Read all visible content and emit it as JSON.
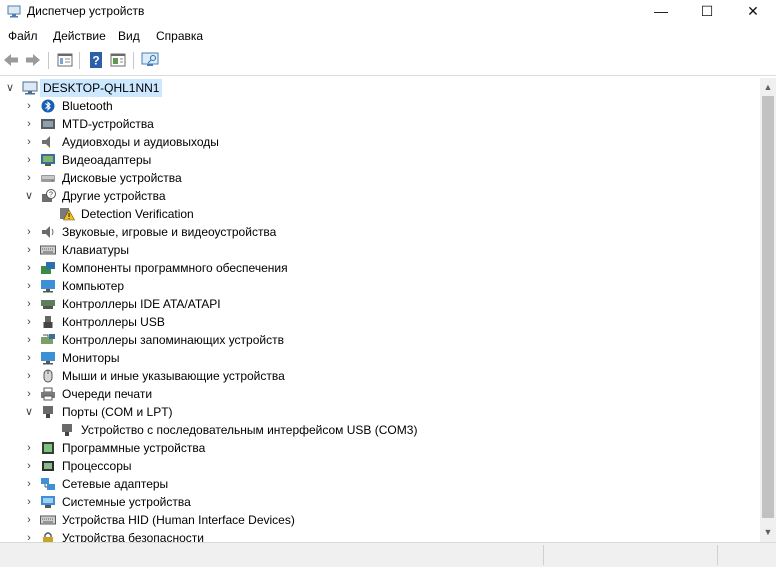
{
  "window": {
    "title": "Диспетчер устройств",
    "minimize": "—",
    "maximize": "☐",
    "close": "✕"
  },
  "menu": [
    "Файл",
    "Действие",
    "Вид",
    "Справка"
  ],
  "toolbar": [
    "back-icon",
    "forward-icon",
    "properties-icon",
    "help-icon",
    "update-driver-icon",
    "scan-hardware-icon"
  ],
  "tree": {
    "root": "DESKTOP-QHL1NN1",
    "rows": [
      {
        "label": "Bluetooth",
        "icon": "bluetooth-icon",
        "expanded": false,
        "level": 1
      },
      {
        "label": "MTD-устройства",
        "icon": "mtd-icon",
        "expanded": false,
        "level": 1
      },
      {
        "label": "Аудиовходы и аудиовыходы",
        "icon": "audio-io-icon",
        "expanded": false,
        "level": 1
      },
      {
        "label": "Видеоадаптеры",
        "icon": "display-adapter-icon",
        "expanded": false,
        "level": 1
      },
      {
        "label": "Дисковые устройства",
        "icon": "disk-icon",
        "expanded": false,
        "level": 1
      },
      {
        "label": "Другие устройства",
        "icon": "unknown-device-icon",
        "expanded": true,
        "level": 1
      },
      {
        "label": "Detection Verification",
        "icon": "warning-device-icon",
        "level": 2
      },
      {
        "label": "Звуковые, игровые и видеоустройства",
        "icon": "sound-icon",
        "expanded": false,
        "level": 1
      },
      {
        "label": "Клавиатуры",
        "icon": "keyboard-icon",
        "expanded": false,
        "level": 1
      },
      {
        "label": "Компоненты программного обеспечения",
        "icon": "software-component-icon",
        "expanded": false,
        "level": 1
      },
      {
        "label": "Компьютер",
        "icon": "computer-icon",
        "expanded": false,
        "level": 1
      },
      {
        "label": "Контроллеры IDE ATA/ATAPI",
        "icon": "ide-controller-icon",
        "expanded": false,
        "level": 1
      },
      {
        "label": "Контроллеры USB",
        "icon": "usb-icon",
        "expanded": false,
        "level": 1
      },
      {
        "label": "Контроллеры запоминающих устройств",
        "icon": "storage-controller-icon",
        "expanded": false,
        "level": 1
      },
      {
        "label": "Мониторы",
        "icon": "monitor-icon",
        "expanded": false,
        "level": 1
      },
      {
        "label": "Мыши и иные указывающие устройства",
        "icon": "mouse-icon",
        "expanded": false,
        "level": 1
      },
      {
        "label": "Очереди печати",
        "icon": "printer-icon",
        "expanded": false,
        "level": 1
      },
      {
        "label": "Порты (COM и LPT)",
        "icon": "port-icon",
        "expanded": true,
        "level": 1
      },
      {
        "label": "Устройство с последовательным интерфейсом USB (COM3)",
        "icon": "serial-port-icon",
        "level": 2
      },
      {
        "label": "Программные устройства",
        "icon": "software-device-icon",
        "expanded": false,
        "level": 1
      },
      {
        "label": "Процессоры",
        "icon": "processor-icon",
        "expanded": false,
        "level": 1
      },
      {
        "label": "Сетевые адаптеры",
        "icon": "network-adapter-icon",
        "expanded": false,
        "level": 1
      },
      {
        "label": "Системные устройства",
        "icon": "system-device-icon",
        "expanded": false,
        "level": 1
      },
      {
        "label": "Устройства HID (Human Interface Devices)",
        "icon": "hid-icon",
        "expanded": false,
        "level": 1
      },
      {
        "label": "Устройства безопасности",
        "icon": "security-device-icon",
        "expanded": false,
        "level": 1
      }
    ]
  },
  "colors": {
    "selection": "#cce8ff",
    "accent": "#2b78c5",
    "warning": "#f2c12e"
  }
}
